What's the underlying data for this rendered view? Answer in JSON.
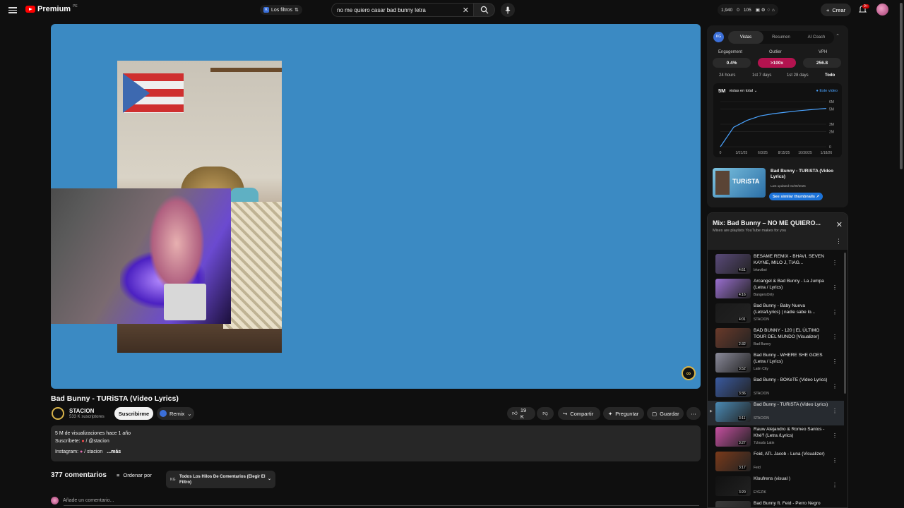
{
  "topbar": {
    "logo_text": "Premium",
    "logo_country": "PE",
    "filter_label": "Los filtros",
    "search_value": "no me quiero casar bad bunny letra",
    "stats": [
      "1,940",
      "0",
      "105"
    ],
    "create_label": "Crear",
    "notifications": "9+"
  },
  "video": {
    "title": "Bad Bunny - TURiSTA (Video Lyrics)",
    "channel": "STACION",
    "subscribers": "533 K suscriptores",
    "subscribe_label": "Suscribirme",
    "remix_label": "Remix",
    "likes": "19 K",
    "share_label": "Compartir",
    "ask_label": "Preguntar",
    "save_label": "Guardar",
    "more_label": "⋯"
  },
  "description": {
    "line1": "5 M de visualizaciones  hace 1 año",
    "line2": "Suscríbete: ",
    "line2_handle": " / @stacion",
    "line3": "Instagram: ",
    "line3_handle": " / stacion",
    "more": "...más"
  },
  "comments": {
    "count": "377 comentarios",
    "sort_label": "Ordenar por",
    "filter_label": "Todos Los Hilos De Comentarios (Elegir El Filtro)",
    "filter_badge": "KG",
    "add_placeholder": "Añade un comentario..."
  },
  "extension": {
    "logo": "KG",
    "tabs": [
      "Vistas",
      "Resumen",
      "AI Coach"
    ],
    "metrics": [
      {
        "label": "Engagement",
        "value": "0.4%"
      },
      {
        "label": "Outlier",
        "value": ">100x"
      },
      {
        "label": "VPH",
        "value": "256.8"
      }
    ],
    "ranges": [
      "24 hours",
      "1st 7 days",
      "1st 28 days",
      "Todo"
    ],
    "graph_total": "5M",
    "graph_select": "vistas en total",
    "graph_legend": "Este video",
    "card_title": "Bad Bunny - TURiSTA (Video Lyrics)",
    "card_updated": "Last updated 01/09/2025",
    "card_button": "See similar thumbnails",
    "thumb_text": "TURiSTA"
  },
  "chart_data": {
    "type": "line",
    "x": [
      "0",
      "3/21/25",
      "6/3/25",
      "8/15/25",
      "10/30/25",
      "1/18/26"
    ],
    "y_ticks": [
      "0",
      "2M",
      "3M",
      "5M",
      "6M"
    ],
    "series": [
      {
        "name": "Este video",
        "values": [
          0,
          2.6,
          3.5,
          4.1,
          4.4,
          4.6,
          4.8,
          4.95,
          5.1
        ]
      }
    ],
    "ylim": [
      0,
      6
    ]
  },
  "mix": {
    "title": "Mix: Bad Bunny – NO ME QUIERO...",
    "subtitle": "Mixes are playlists YouTube makes for you",
    "items": [
      {
        "title": "BESAME REMIX - BHAVI, SEVEN KAYNE, MILO J, TIAG...",
        "channel": "bhaviboi",
        "duration": "4:51",
        "color": "#5a4a7a"
      },
      {
        "title": "Arcangel & Bad Bunny - La Jumpa (Letra / Lyrics)",
        "channel": "BangersOnly",
        "duration": "4:16",
        "color": "#9a6fd0"
      },
      {
        "title": "Bad Bunny - Baby Nueva (Letra/Lyrics) | nadie sabe lo...",
        "channel": "STACION",
        "duration": "4:01",
        "color": "#1a1a1a"
      },
      {
        "title": "BAD BUNNY - 120 | EL ÚLTIMO TOUR DEL MUNDO [Visualizer]",
        "channel": "Bad Bunny",
        "duration": "2:32",
        "color": "#6a3a2a"
      },
      {
        "title": "Bad Bunny - WHERE SHE GOES (Letra / Lyrics)",
        "channel": "Latin City",
        "duration": "3:52",
        "color": "#8a8a9a"
      },
      {
        "title": "Bad Bunny - BOKeTE (Video Lyrics)",
        "channel": "STACION",
        "duration": "3:36",
        "color": "#3a5aa0"
      },
      {
        "title": "Bad Bunny - TURiSTA (Video Lyrics)",
        "channel": "STACION",
        "duration": "3:11",
        "color": "#4a8ab5"
      },
      {
        "title": "Rauw Alejandro & Romeo Santos - Khé? (Letra /Lyrics)",
        "channel": "7clouds Latin",
        "duration": "3:27",
        "color": "#c64fa0"
      },
      {
        "title": "Feid, ATL Jacob - Luna (Visualizer)",
        "channel": "Feid",
        "duration": "3:17",
        "color": "#7a3a1a"
      },
      {
        "title": "Kloufrens (visual )",
        "channel": "EYEZIK",
        "duration": "3:20",
        "color": "#111111"
      },
      {
        "title": "Bad Bunny ft. Feid - Perro Negro (Letra / Lyrics)",
        "channel": "",
        "duration": "",
        "color": "#3a3a3a"
      }
    ]
  }
}
